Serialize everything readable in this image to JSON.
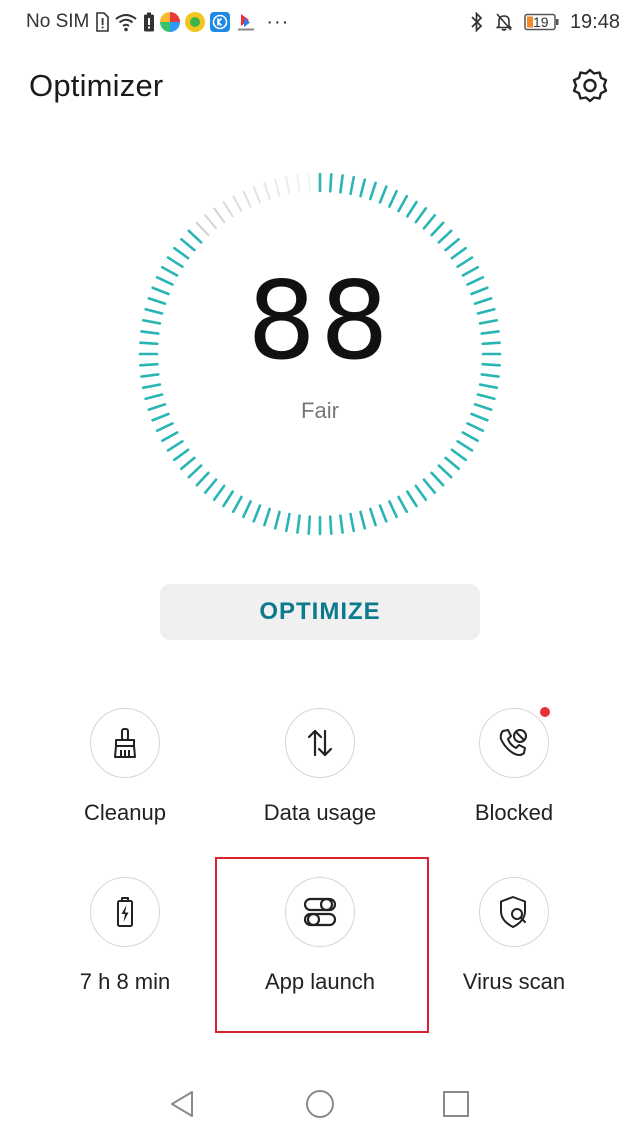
{
  "status_bar": {
    "carrier": "No SIM",
    "battery_level": "19",
    "more_indicator": "···",
    "time": "19:48",
    "icons": [
      "sim-alert-icon",
      "wifi-icon",
      "battery-saver-icon",
      "app-notification-icon",
      "bluetooth-icon",
      "mute-icon",
      "battery-icon"
    ]
  },
  "header": {
    "title": "Optimizer",
    "settings_icon": "gear-icon"
  },
  "score": {
    "value": "88",
    "label": "Fair",
    "fill_fraction": 0.88,
    "accent_color": "#2ab5b5"
  },
  "optimize_button": {
    "label": "OPTIMIZE",
    "color": "#0b7a8c"
  },
  "tools": [
    {
      "label": "Cleanup",
      "icon": "broom-icon"
    },
    {
      "label": "Data usage",
      "icon": "transfer-arrows-icon"
    },
    {
      "label": "Blocked",
      "icon": "blocked-call-icon",
      "has_notification": true
    },
    {
      "label": "7 h 8 min",
      "icon": "battery-charging-icon"
    },
    {
      "label": "App launch",
      "icon": "app-launch-toggle-icon",
      "highlighted": true
    },
    {
      "label": "Virus scan",
      "icon": "shield-search-icon"
    }
  ],
  "nav_bar": {
    "icons": [
      "back-icon",
      "home-icon",
      "recents-icon"
    ]
  },
  "colors": {
    "highlight": "#d9232e",
    "notification": "#e8323a"
  }
}
